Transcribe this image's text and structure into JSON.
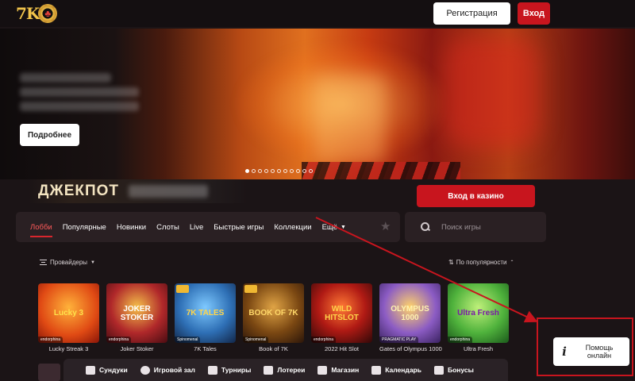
{
  "header": {
    "logo_text": "7K",
    "register_label": "Регистрация",
    "login_label": "Вход"
  },
  "hero": {
    "more_label": "Подробнее",
    "slides_count": 11,
    "active_slide": 1
  },
  "jackpot": {
    "label": "ДЖЕКПОТ"
  },
  "casino_button_label": "Вход в казино",
  "nav": {
    "items": [
      {
        "label": "Лобби",
        "active": true
      },
      {
        "label": "Популярные"
      },
      {
        "label": "Новинки"
      },
      {
        "label": "Слоты"
      },
      {
        "label": "Live"
      },
      {
        "label": "Быстрые игры"
      },
      {
        "label": "Коллекции"
      },
      {
        "label": "Ещё"
      }
    ],
    "favorites_icon": "star-icon"
  },
  "search": {
    "placeholder": "Поиск игры"
  },
  "filters": {
    "providers_label": "Провайдеры",
    "sort_label": "По популярности"
  },
  "games": [
    {
      "name": "Lucky Streak 3",
      "logo": "Lucky 3",
      "provider": "endorphina"
    },
    {
      "name": "Joker Stoker",
      "logo": "JOKER STOKER",
      "provider": "endorphina"
    },
    {
      "name": "7K Tales",
      "logo": "7K TALES",
      "provider": "Spinomenal"
    },
    {
      "name": "Book of 7K",
      "logo": "BOOK OF 7K",
      "provider": "Spinomenal"
    },
    {
      "name": "2022 Hit Slot",
      "logo": "WILD HITSLOT",
      "provider": "endorphina"
    },
    {
      "name": "Gates of Olympus 1000",
      "logo": "OLYMPUS 1000",
      "provider": "PRAGMATIC PLAY"
    },
    {
      "name": "Ultra Fresh",
      "logo": "Ultra Fresh",
      "provider": "endorphina"
    }
  ],
  "bottom_bar": [
    {
      "label": "Сундуки",
      "icon": "chest-icon"
    },
    {
      "label": "Игровой зал",
      "icon": "chip-icon"
    },
    {
      "label": "Турниры",
      "icon": "trophy-icon"
    },
    {
      "label": "Лотереи",
      "icon": "ticket-icon"
    },
    {
      "label": "Магазин",
      "icon": "bag-icon"
    },
    {
      "label": "Календарь",
      "icon": "calendar-icon"
    },
    {
      "label": "Бонусы",
      "icon": "gift-icon"
    }
  ],
  "help": {
    "icon": "info-icon",
    "line1": "Помощь",
    "line2": "онлайн"
  },
  "colors": {
    "accent_red": "#c8151e",
    "background": "#1b1416",
    "panel": "#2a2023",
    "gold": "#f2c44b"
  }
}
